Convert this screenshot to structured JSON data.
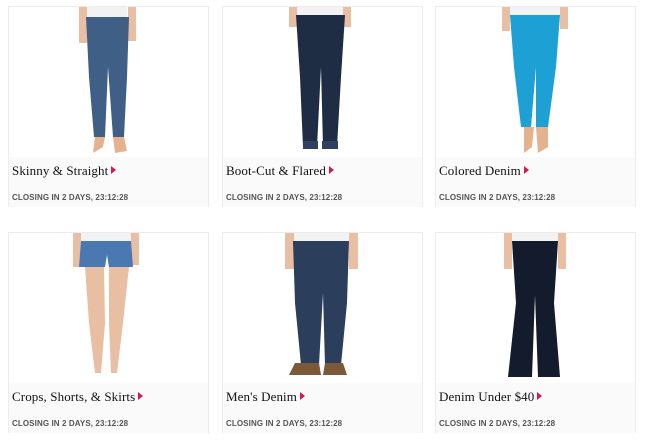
{
  "categories": [
    {
      "title": "Skinny & Straight",
      "closing": "CLOSING IN 2 DAYS, 23:12:28",
      "photo": "skinny-jeans-model",
      "denim_color": "#3f5f86"
    },
    {
      "title": "Boot-Cut & Flared",
      "closing": "CLOSING IN 2 DAYS, 23:12:28",
      "photo": "bootcut-jeans-model",
      "denim_color": "#1f2d44"
    },
    {
      "title": "Colored Denim",
      "closing": "CLOSING IN 2 DAYS, 23:12:28",
      "photo": "colored-jeans-model",
      "denim_color": "#1da0d4"
    },
    {
      "title": "Crops, Shorts, & Skirts",
      "closing": "CLOSING IN 2 DAYS, 23:12:28",
      "photo": "denim-shorts-model",
      "denim_color": "#4a78b0"
    },
    {
      "title": "Men's Denim",
      "closing": "CLOSING IN 2 DAYS, 23:12:28",
      "photo": "mens-jeans-model",
      "denim_color": "#2b3e5c"
    },
    {
      "title": "Denim Under $40",
      "closing": "CLOSING IN 2 DAYS, 23:12:28",
      "photo": "flare-jeans-model",
      "denim_color": "#141b2c"
    }
  ],
  "colors": {
    "arrow": "#d1185a",
    "skin": "#e9bfa3",
    "top": "#f2f2f2"
  }
}
